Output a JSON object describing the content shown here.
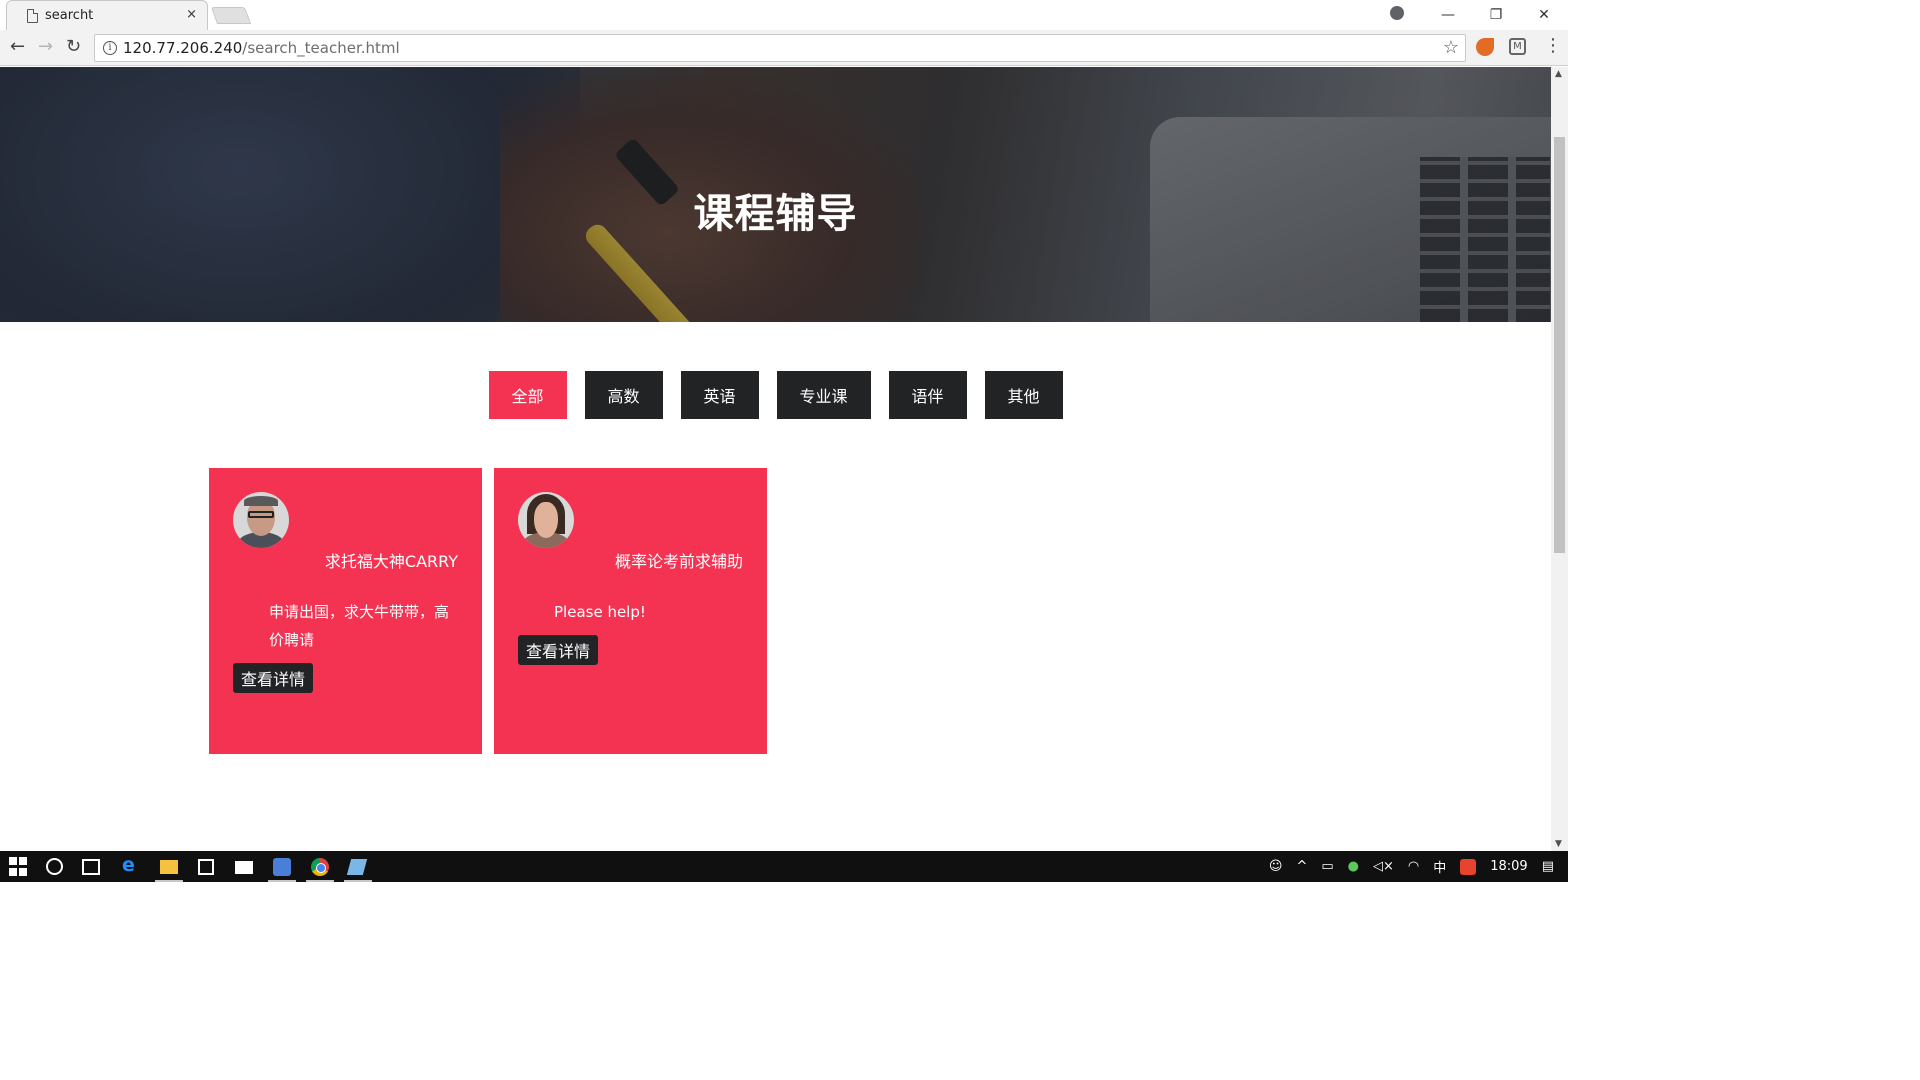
{
  "browser": {
    "tab_title": "searcht",
    "tab_close": "×",
    "url_host": "120.77.206.240",
    "url_path": "/search_teacher.html",
    "info_icon": "i",
    "star_icon": "☆",
    "window_controls": {
      "minimize": "—",
      "restore": "❐",
      "close": "✕"
    }
  },
  "hero": {
    "title": "课程辅导"
  },
  "filters": [
    {
      "label": "全部",
      "active": true
    },
    {
      "label": "高数",
      "active": false
    },
    {
      "label": "英语",
      "active": false
    },
    {
      "label": "专业课",
      "active": false
    },
    {
      "label": "语伴",
      "active": false
    },
    {
      "label": "其他",
      "active": false
    }
  ],
  "cards": [
    {
      "title": "求托福大神CARRY",
      "description": "申请出国，求大牛带带，高价聘请",
      "button": "查看详情",
      "avatar": "male-avatar"
    },
    {
      "title": "概率论考前求辅助",
      "description": "Please help!",
      "button": "查看详情",
      "avatar": "female-avatar"
    }
  ],
  "taskbar": {
    "ime": "中",
    "time": "18:09"
  },
  "colors": {
    "accent": "#f43353",
    "dark_button": "#222325"
  }
}
